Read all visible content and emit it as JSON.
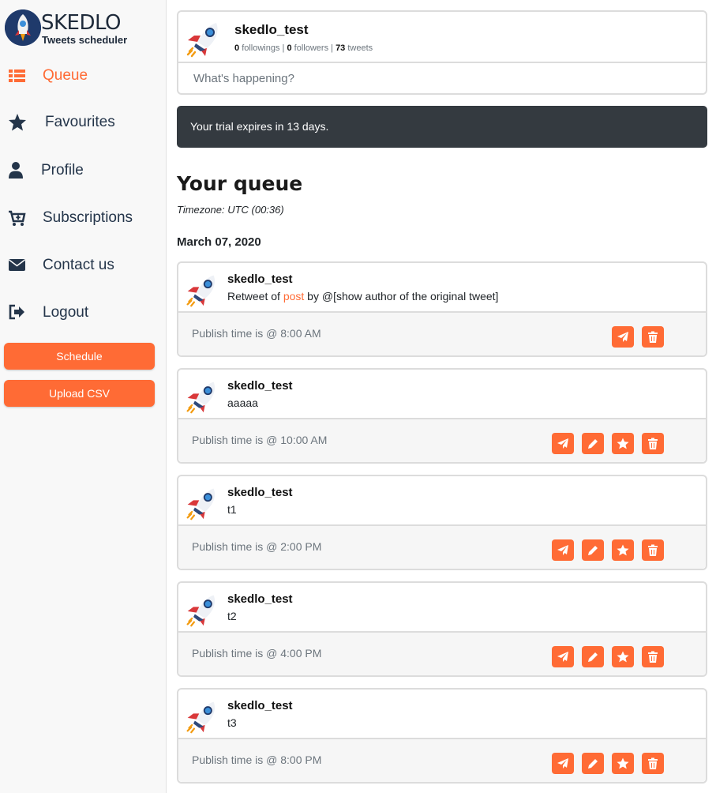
{
  "app": {
    "logo_name": "SKEDLO",
    "logo_tagline": "Tweets scheduler",
    "accent": "#ff6b35"
  },
  "sidebar": {
    "items": [
      {
        "label": "Queue",
        "icon": "list-icon",
        "active": true
      },
      {
        "label": "Favourites",
        "icon": "star-icon"
      },
      {
        "label": "Profile",
        "icon": "user-icon"
      },
      {
        "label": "Subscriptions",
        "icon": "cart-icon"
      },
      {
        "label": "Contact us",
        "icon": "envelope-icon"
      },
      {
        "label": "Logout",
        "icon": "logout-icon"
      }
    ],
    "schedule_label": "Schedule",
    "upload_label": "Upload CSV"
  },
  "profile": {
    "username": "skedlo_test",
    "followings_count": "0",
    "followings_label": "followings",
    "followers_count": "0",
    "followers_label": "followers",
    "tweets_count": "73",
    "tweets_label": "tweets",
    "compose_placeholder": "What's happening?"
  },
  "trial_notice": "Your trial expires in 13 days.",
  "queue": {
    "title": "Your queue",
    "timezone": "Timezone: UTC (00:36)",
    "date": "March 07, 2020",
    "tweets": [
      {
        "user": "skedlo_test",
        "text_before": "Retweet of ",
        "link": "post",
        "text_after": " by @[show author of the original tweet]",
        "publish": "Publish time is @ 8:00 AM",
        "retweet": true
      },
      {
        "user": "skedlo_test",
        "text_before": "aaaaa",
        "link": "",
        "text_after": "",
        "publish": "Publish time is @ 10:00 AM",
        "retweet": false
      },
      {
        "user": "skedlo_test",
        "text_before": "t1",
        "link": "",
        "text_after": "",
        "publish": "Publish time is @ 2:00 PM",
        "retweet": false
      },
      {
        "user": "skedlo_test",
        "text_before": "t2",
        "link": "",
        "text_after": "",
        "publish": "Publish time is @ 4:00 PM",
        "retweet": false
      },
      {
        "user": "skedlo_test",
        "text_before": "t3",
        "link": "",
        "text_after": "",
        "publish": "Publish time is @ 8:00 PM",
        "retweet": false
      }
    ]
  }
}
